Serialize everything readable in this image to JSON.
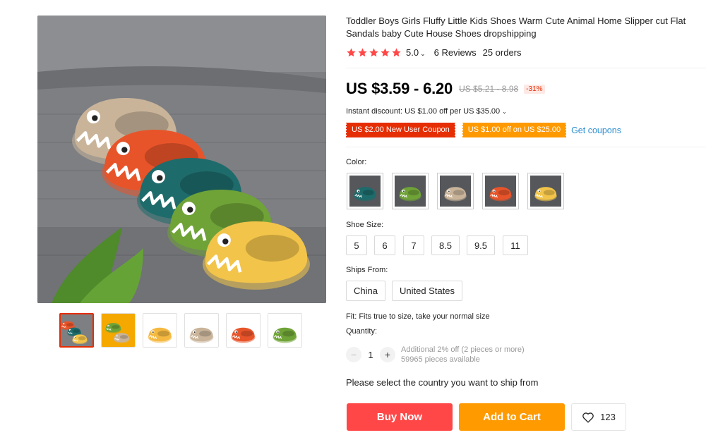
{
  "product": {
    "title": "Toddler Boys Girls Fluffy Little Kids Shoes Warm Cute Animal Home Slipper cut Flat Sandals baby Cute House Shoes dropshipping"
  },
  "rating": {
    "stars": 5,
    "value": "5.0",
    "reviews": "6 Reviews",
    "orders": "25 orders",
    "star_color": "#ff4747"
  },
  "price": {
    "current": "US $3.59 - 6.20",
    "original": "US $5.21 - 8.98",
    "discount": "-31%"
  },
  "promo": {
    "instant_discount": "Instant discount: US $1.00 off per US $35.00",
    "coupon_new_user": "US $2.00 New User Coupon",
    "coupon_store": "US $1.00 off on US $25.00",
    "get_coupons": "Get coupons"
  },
  "options": {
    "color_label": "Color:",
    "colors": [
      "teal",
      "green",
      "beige",
      "orange",
      "yellow"
    ],
    "size_label": "Shoe Size:",
    "sizes": [
      "5",
      "6",
      "7",
      "8.5",
      "9.5",
      "11"
    ],
    "ships_from_label": "Ships From:",
    "ships_from": [
      "China",
      "United States"
    ]
  },
  "fit": "Fit: Fits true to size, take your normal size",
  "quantity": {
    "label": "Quantity:",
    "value": "1",
    "note": "Additional 2% off (2 pieces or more)",
    "available": "59965 pieces available"
  },
  "ship_prompt": "Please select the country you want to ship from",
  "actions": {
    "buy_now": "Buy Now",
    "add_to_cart": "Add to Cart",
    "wishlist_count": "123"
  },
  "colors": {
    "accent_red": "#ff4747",
    "accent_orange": "#ff9a00",
    "coupon_red": "#e62e04",
    "link_blue": "#2e8fd1"
  },
  "icons": {
    "star": "star-icon",
    "heart": "heart-icon",
    "minus": "minus-icon",
    "plus": "plus-icon",
    "caret": "chevron-down-icon"
  }
}
